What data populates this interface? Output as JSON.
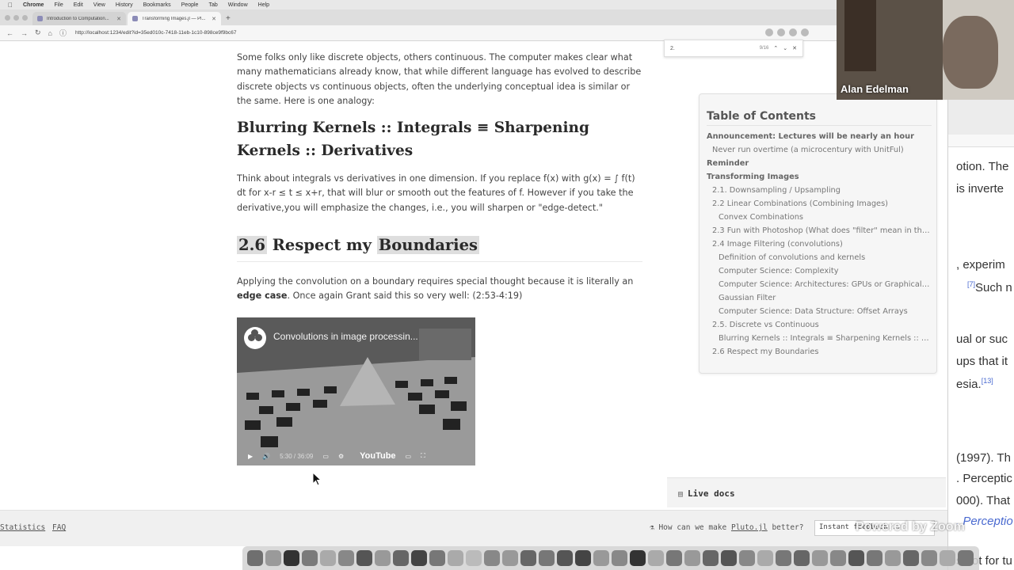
{
  "menubar": {
    "app": "Chrome",
    "items": [
      "File",
      "Edit",
      "View",
      "History",
      "Bookmarks",
      "People",
      "Tab",
      "Window",
      "Help"
    ]
  },
  "tabs": [
    {
      "label": "Introduction to Computation...",
      "active": false
    },
    {
      "label": "Transforming Images.jl — Pl...",
      "active": true
    }
  ],
  "address": {
    "url": "http://localhost:1234/edit?id=35ed010c-7418-11eb-1c10-898ce9f9bc67"
  },
  "find": {
    "query": "2.",
    "count": "9/16"
  },
  "content": {
    "intro": "Some folks only like discrete objects, others continuous. The computer makes clear what many mathematicians already know, that while different language has evolved to describe discrete objects vs continuous objects, often the underlying conceptual idea is similar or the same. Here is one analogy:",
    "heading_blur": "Blurring Kernels :: Integrals ≡ Sharpening Kernels :: Derivatives",
    "integrals_para": "Think about integrals vs derivatives in one dimension. If you replace f(x) with g(x) = ∫ f(t) dt for x-r ≤ t ≤ x+r, that will blur or smooth out the features of f. However if you take the derivative,you will emphasize the changes, i.e., you will sharpen or \"edge-detect.\"",
    "section_num": "2.6",
    "section_mid": " Respect my ",
    "section_word": "Boundaries",
    "boundary_para_a": "Applying the convolution on a boundary requires special thought because it is literally an ",
    "boundary_strong": "edge case",
    "boundary_para_b": ". Once again Grant said this so very well: (2:53-4:19)"
  },
  "video": {
    "title": "Convolutions in image processin...",
    "time": "5:30 / 36:09",
    "brand": "YouTube"
  },
  "toc": {
    "title": "Table of Contents",
    "items": [
      {
        "label": "Announcement: Lectures will be nearly an hour",
        "level": 1
      },
      {
        "label": "Never run overtime (a microcentury with UnitFul)",
        "level": 2
      },
      {
        "label": "Reminder",
        "level": 1
      },
      {
        "label": "Transforming Images",
        "level": 1
      },
      {
        "label": "2.1. Downsampling / Upsampling",
        "level": 2
      },
      {
        "label": "2.2 Linear Combinations (Combining Images)",
        "level": 2
      },
      {
        "label": "Convex Combinations",
        "level": 3
      },
      {
        "label": "2.3 Fun with Photoshop (What does \"filter\" mean in thi...",
        "level": 2
      },
      {
        "label": "2.4 Image Filtering (convolutions)",
        "level": 2
      },
      {
        "label": "Definition of convolutions and kernels",
        "level": 3
      },
      {
        "label": "Computer Science: Complexity",
        "level": 3
      },
      {
        "label": "Computer Science: Architectures: GPUs or Graphical ...",
        "level": 3
      },
      {
        "label": "Gaussian Filter",
        "level": 3
      },
      {
        "label": "Computer Science: Data Structure: Offset Arrays",
        "level": 3
      },
      {
        "label": "2.5. Discrete vs Continuous",
        "level": 2
      },
      {
        "label": "Blurring Kernels :: Integrals ≡ Sharpening Kernels :: D...",
        "level": 3
      },
      {
        "label": "2.6 Respect my Boundaries",
        "level": 2
      }
    ]
  },
  "webcam": {
    "name": "Alan Edelman"
  },
  "bg_window": {
    "frags": [
      {
        "text": "otion. The",
        "sup": ""
      },
      {
        "text": "is inverte",
        "sup": ""
      },
      {
        "text": ", experim",
        "sup": ""
      },
      {
        "text": "Such n",
        "sup": "[7]"
      },
      {
        "text": "ual or suc",
        "sup": ""
      },
      {
        "text": "ups that it",
        "sup": ""
      },
      {
        "text": "esia.",
        "sup": "[13]"
      },
      {
        "text": "(1997). Th",
        "sup": ""
      },
      {
        "text": ". Perceptic",
        "sup": ""
      },
      {
        "text": "000). That",
        "sup": ""
      },
      {
        "text": ". Perceptio",
        "sup": ""
      },
      {
        "text": "s not for tu",
        "sup": ""
      }
    ]
  },
  "livedocs": {
    "label": "Live docs"
  },
  "footer": {
    "statistics": "Statistics",
    "faq": "FAQ",
    "question": "How can we make ",
    "question_link": "Pluto.jl",
    "question_end": " better?",
    "feedback_placeholder": "Instant feedback...",
    "watermark": "Powered by Zoom"
  }
}
